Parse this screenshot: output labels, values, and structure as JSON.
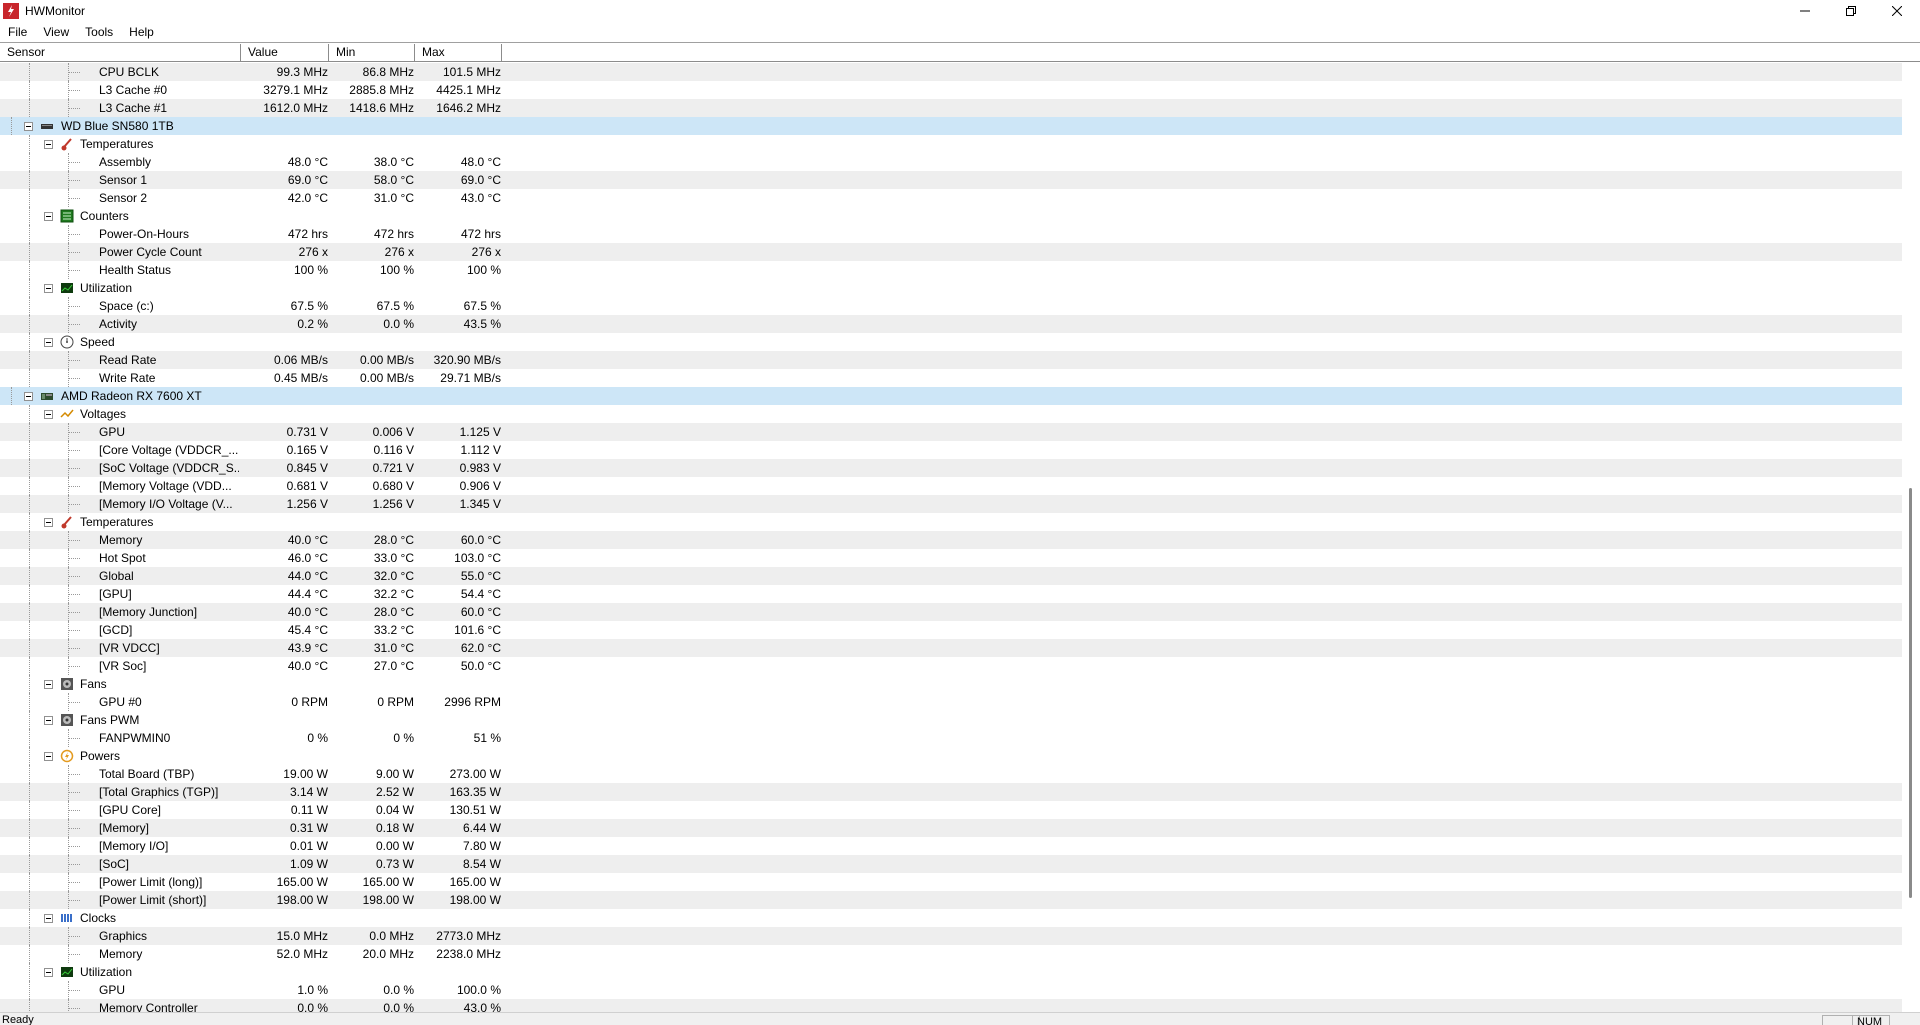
{
  "window": {
    "title": "HWMonitor"
  },
  "menu": [
    "File",
    "View",
    "Tools",
    "Help"
  ],
  "columns": {
    "sensor": "Sensor",
    "value": "Value",
    "min": "Min",
    "max": "Max"
  },
  "status": {
    "text": "Ready",
    "num": "NUM"
  },
  "colors": {
    "device_row": "#cde6f7",
    "alt_row": "#eeeeee",
    "app_icon": "#c8262c"
  },
  "rows": [
    {
      "type": "sensor",
      "label": "CPU BCLK",
      "value": "99.3 MHz",
      "min": "86.8 MHz",
      "max": "101.5 MHz"
    },
    {
      "type": "sensor",
      "label": "L3 Cache #0",
      "value": "3279.1 MHz",
      "min": "2885.8 MHz",
      "max": "4425.1 MHz"
    },
    {
      "type": "sensor",
      "label": "L3 Cache #1",
      "value": "1612.0 MHz",
      "min": "1418.6 MHz",
      "max": "1646.2 MHz"
    },
    {
      "type": "device",
      "label": "WD Blue SN580 1TB",
      "icon": "drive-icon"
    },
    {
      "type": "group",
      "label": "Temperatures",
      "icon": "thermometer-icon"
    },
    {
      "type": "sensor",
      "label": "Assembly",
      "value": "48.0 °C",
      "min": "38.0 °C",
      "max": "48.0 °C"
    },
    {
      "type": "sensor",
      "label": "Sensor 1",
      "value": "69.0 °C",
      "min": "58.0 °C",
      "max": "69.0 °C"
    },
    {
      "type": "sensor",
      "label": "Sensor 2",
      "value": "42.0 °C",
      "min": "31.0 °C",
      "max": "43.0 °C"
    },
    {
      "type": "group",
      "label": "Counters",
      "icon": "counter-icon"
    },
    {
      "type": "sensor",
      "label": "Power-On-Hours",
      "value": "472 hrs",
      "min": "472 hrs",
      "max": "472 hrs"
    },
    {
      "type": "sensor",
      "label": "Power Cycle Count",
      "value": "276 x",
      "min": "276 x",
      "max": "276 x"
    },
    {
      "type": "sensor",
      "label": "Health Status",
      "value": "100 %",
      "min": "100 %",
      "max": "100 %"
    },
    {
      "type": "group",
      "label": "Utilization",
      "icon": "utilization-icon"
    },
    {
      "type": "sensor",
      "label": "Space (c:)",
      "value": "67.5 %",
      "min": "67.5 %",
      "max": "67.5 %"
    },
    {
      "type": "sensor",
      "label": "Activity",
      "value": "0.2 %",
      "min": "0.0 %",
      "max": "43.5 %"
    },
    {
      "type": "group",
      "label": "Speed",
      "icon": "speed-icon"
    },
    {
      "type": "sensor",
      "label": "Read Rate",
      "value": "0.06 MB/s",
      "min": "0.00 MB/s",
      "max": "320.90 MB/s"
    },
    {
      "type": "sensor",
      "label": "Write Rate",
      "value": "0.45 MB/s",
      "min": "0.00 MB/s",
      "max": "29.71 MB/s"
    },
    {
      "type": "device",
      "label": "AMD Radeon RX 7600 XT",
      "icon": "gpu-icon"
    },
    {
      "type": "group",
      "label": "Voltages",
      "icon": "voltage-icon"
    },
    {
      "type": "sensor",
      "label": "GPU",
      "value": "0.731 V",
      "min": "0.006 V",
      "max": "1.125 V"
    },
    {
      "type": "sensor",
      "label": "[Core Voltage (VDDCR_...",
      "value": "0.165 V",
      "min": "0.116 V",
      "max": "1.112 V"
    },
    {
      "type": "sensor",
      "label": "[SoC Voltage (VDDCR_S...",
      "value": "0.845 V",
      "min": "0.721 V",
      "max": "0.983 V"
    },
    {
      "type": "sensor",
      "label": "[Memory Voltage (VDD...",
      "value": "0.681 V",
      "min": "0.680 V",
      "max": "0.906 V"
    },
    {
      "type": "sensor",
      "label": "[Memory I/O Voltage (V...",
      "value": "1.256 V",
      "min": "1.256 V",
      "max": "1.345 V"
    },
    {
      "type": "group",
      "label": "Temperatures",
      "icon": "thermometer-icon"
    },
    {
      "type": "sensor",
      "label": "Memory",
      "value": "40.0 °C",
      "min": "28.0 °C",
      "max": "60.0 °C"
    },
    {
      "type": "sensor",
      "label": "Hot Spot",
      "value": "46.0 °C",
      "min": "33.0 °C",
      "max": "103.0 °C"
    },
    {
      "type": "sensor",
      "label": "Global",
      "value": "44.0 °C",
      "min": "32.0 °C",
      "max": "55.0 °C"
    },
    {
      "type": "sensor",
      "label": "[GPU]",
      "value": "44.4 °C",
      "min": "32.2 °C",
      "max": "54.4 °C"
    },
    {
      "type": "sensor",
      "label": "[Memory Junction]",
      "value": "40.0 °C",
      "min": "28.0 °C",
      "max": "60.0 °C"
    },
    {
      "type": "sensor",
      "label": "[GCD]",
      "value": "45.4 °C",
      "min": "33.2 °C",
      "max": "101.6 °C"
    },
    {
      "type": "sensor",
      "label": "[VR VDCC]",
      "value": "43.9 °C",
      "min": "31.0 °C",
      "max": "62.0 °C"
    },
    {
      "type": "sensor",
      "label": "[VR Soc]",
      "value": "40.0 °C",
      "min": "27.0 °C",
      "max": "50.0 °C"
    },
    {
      "type": "group",
      "label": "Fans",
      "icon": "fan-icon"
    },
    {
      "type": "sensor",
      "label": "GPU #0",
      "value": "0 RPM",
      "min": "0 RPM",
      "max": "2996 RPM"
    },
    {
      "type": "group",
      "label": "Fans PWM",
      "icon": "fan-icon"
    },
    {
      "type": "sensor",
      "label": "FANPWMIN0",
      "value": "0 %",
      "min": "0 %",
      "max": "51 %"
    },
    {
      "type": "group",
      "label": "Powers",
      "icon": "power-icon"
    },
    {
      "type": "sensor",
      "label": "Total Board (TBP)",
      "value": "19.00 W",
      "min": "9.00 W",
      "max": "273.00 W"
    },
    {
      "type": "sensor",
      "label": "[Total Graphics (TGP)]",
      "value": "3.14 W",
      "min": "2.52 W",
      "max": "163.35 W"
    },
    {
      "type": "sensor",
      "label": "[GPU Core]",
      "value": "0.11 W",
      "min": "0.04 W",
      "max": "130.51 W"
    },
    {
      "type": "sensor",
      "label": "[Memory]",
      "value": "0.31 W",
      "min": "0.18 W",
      "max": "6.44 W"
    },
    {
      "type": "sensor",
      "label": "[Memory I/O]",
      "value": "0.01 W",
      "min": "0.00 W",
      "max": "7.80 W"
    },
    {
      "type": "sensor",
      "label": "[SoC]",
      "value": "1.09 W",
      "min": "0.73 W",
      "max": "8.54 W"
    },
    {
      "type": "sensor",
      "label": "[Power Limit (long)]",
      "value": "165.00 W",
      "min": "165.00 W",
      "max": "165.00 W"
    },
    {
      "type": "sensor",
      "label": "[Power Limit (short)]",
      "value": "198.00 W",
      "min": "198.00 W",
      "max": "198.00 W"
    },
    {
      "type": "group",
      "label": "Clocks",
      "icon": "clock-icon"
    },
    {
      "type": "sensor",
      "label": "Graphics",
      "value": "15.0 MHz",
      "min": "0.0 MHz",
      "max": "2773.0 MHz"
    },
    {
      "type": "sensor",
      "label": "Memory",
      "value": "52.0 MHz",
      "min": "20.0 MHz",
      "max": "2238.0 MHz"
    },
    {
      "type": "group",
      "label": "Utilization",
      "icon": "utilization-icon"
    },
    {
      "type": "sensor",
      "label": "GPU",
      "value": "1.0 %",
      "min": "0.0 %",
      "max": "100.0 %"
    },
    {
      "type": "sensor",
      "label": "Memory Controller",
      "value": "0.0 %",
      "min": "0.0 %",
      "max": "43.0 %"
    }
  ]
}
